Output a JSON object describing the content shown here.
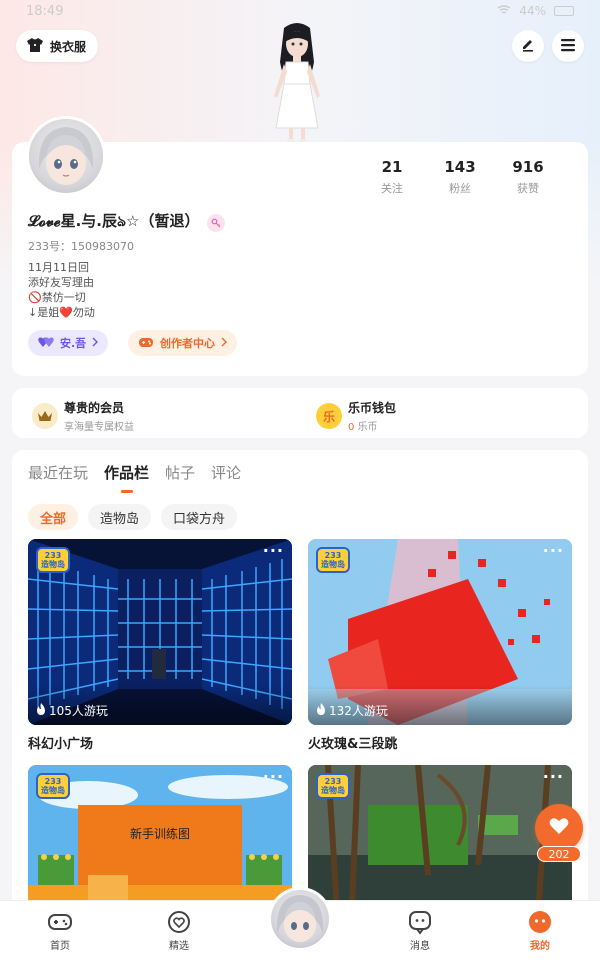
{
  "status": {
    "time": "18:49",
    "battery": "44%"
  },
  "header": {
    "outfit_label": "换衣服"
  },
  "profile": {
    "nickname": "𝓛𝓸𝓿𝓮星.与.辰ঌ☆（暂退）",
    "uid_label": "233号：",
    "uid_value": "150983070",
    "bio": [
      "11月11日回",
      "添好友写理由",
      "🚫禁仿一切",
      "↓是姐❤️勿动"
    ],
    "stats": [
      {
        "value": "21",
        "label": "关注"
      },
      {
        "value": "143",
        "label": "粉丝"
      },
      {
        "value": "916",
        "label": "获赞"
      }
    ],
    "chip_friend": "安.吾",
    "chip_creator": "创作者中心"
  },
  "member": {
    "vip_title": "尊贵的会员",
    "vip_sub": "享海量专属权益",
    "wallet_title": "乐币钱包",
    "wallet_amount": "0",
    "wallet_unit": "乐币",
    "wallet_icon_text": "乐"
  },
  "works": {
    "tabs": [
      "最近在玩",
      "作品栏",
      "帖子",
      "评论"
    ],
    "active_tab": "作品栏",
    "filters": [
      "全部",
      "造物岛",
      "口袋方舟"
    ],
    "logo_text": "233\n造物岛",
    "games": [
      {
        "title": "科幻小广场",
        "plays": "105人游玩"
      },
      {
        "title": "火玫瑰&三段跳",
        "plays": "132人游玩"
      },
      {
        "title": "",
        "plays": "",
        "banner": "新手训练图"
      },
      {
        "title": "",
        "plays": ""
      }
    ]
  },
  "like": {
    "count": "202"
  },
  "nav": {
    "items": [
      "首页",
      "精选",
      "消息",
      "我的"
    ],
    "active": "我的"
  },
  "colors": {
    "accent": "#f0682a",
    "purple": "#6a56e8"
  }
}
